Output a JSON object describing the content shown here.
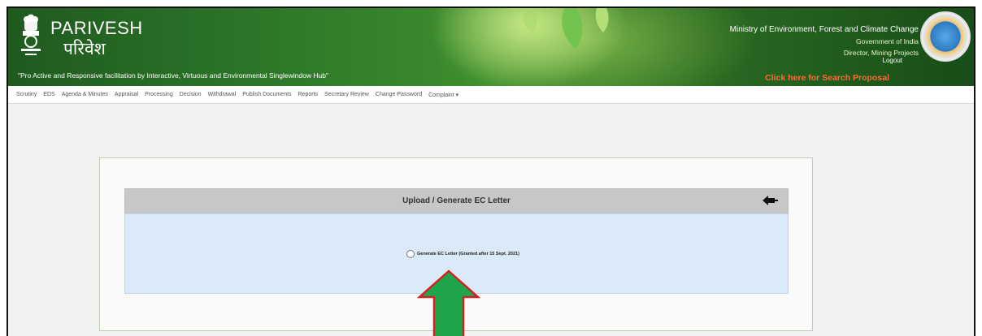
{
  "header": {
    "brand_en": "PARIVESH",
    "brand_hi": "परिवेश",
    "tagline": "\"Pro Active and Responsive facilitation by Interactive, Virtuous and Environmental Singlewindow Hub\"",
    "ministry_line1": "Ministry of Environment, Forest and Climate Change",
    "ministry_line2": "Government of India",
    "user_role": "Director, Mining Projects",
    "logout_label": "Logout",
    "search_link": "Click here for Search Proposal"
  },
  "nav": {
    "items": [
      "Scrutiny",
      "EDS",
      "Agenda & Minutes",
      "Appraisal",
      "Processing",
      "Decision",
      "Withdrawal",
      "Publish Documents",
      "Reports",
      "Secretary Review",
      "Change Password",
      "Complaint ▾"
    ]
  },
  "panel": {
    "title": "Upload / Generate EC Letter",
    "option_label": "Generate EC Letter (Granted after 15 Sept. 2021)"
  },
  "colors": {
    "header_green": "#2f7a2a",
    "search_link": "#ff6a3a",
    "arrow_green": "#1fa64a",
    "arrow_outline": "#d62020",
    "panel_body": "#daeaf8"
  }
}
